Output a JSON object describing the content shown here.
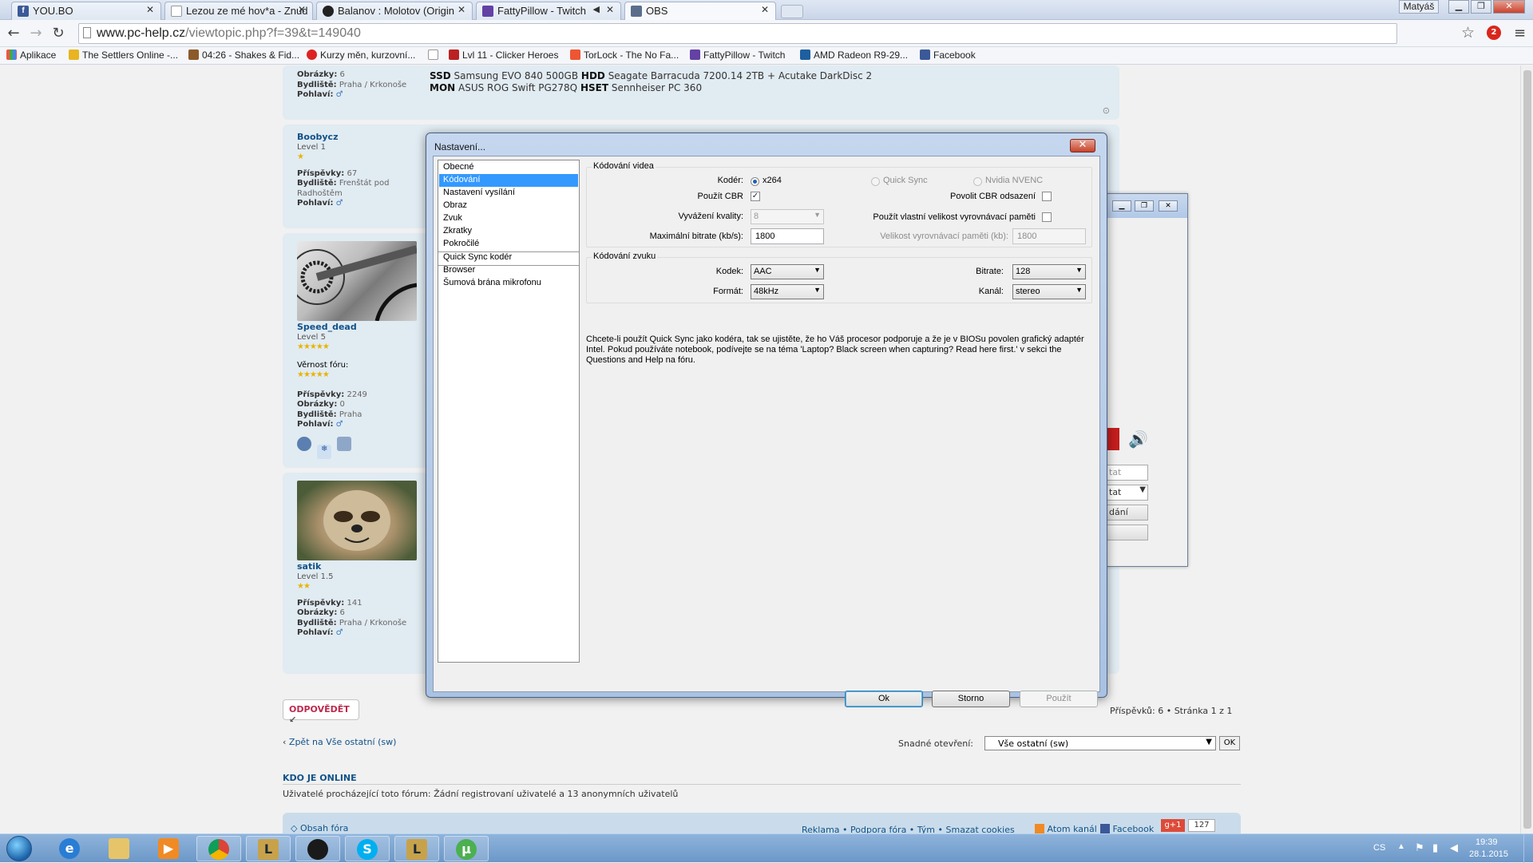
{
  "browser": {
    "tabs": [
      {
        "title": "YOU.BO",
        "icon": "facebook-icon",
        "color": "#3b5998"
      },
      {
        "title": "Lezou ze mé hov*a - Znud",
        "icon": "page-icon",
        "color": "#ffffff"
      },
      {
        "title": "Balanov : Molotov (Origin",
        "icon": "obs-icon",
        "color": "#222222"
      },
      {
        "title": "FattyPillow - Twitch",
        "icon": "twitch-icon",
        "color": "#6441a5"
      },
      {
        "title": "OBS",
        "icon": "obs-tab-icon",
        "color": "#5a6e8c"
      }
    ],
    "user": "Matyáš",
    "url_host": "www.pc-help.cz",
    "url_path": "/viewtopic.php?f=39&t=149040",
    "bookmarks": [
      "Aplikace",
      "The Settlers Online -...",
      "04:26 - Shakes & Fid...",
      "Kurzy měn, kurzovní...",
      "",
      "Lvl 11 - Clicker Heroes",
      "TorLock - The No Fa...",
      "FattyPillow - Twitch",
      "AMD Radeon R9-29...",
      "Facebook"
    ],
    "ext_badge": "2"
  },
  "forum": {
    "post0": {
      "obrazky_label": "Obrázky:",
      "obrazky": "6",
      "bydliste_label": "Bydliště:",
      "bydliste": "Praha / Krkonoše",
      "pohlavi_label": "Pohlaví:",
      "sig_line1_a": "SSD",
      "sig_line1_b": " Samsung EVO 840 500GB ",
      "sig_line1_c": "HDD",
      "sig_line1_d": " Seagate Barracuda 7200.14 2TB + Acutake DarkDisc 2",
      "sig_line2_a": "MON",
      "sig_line2_b": " ASUS ROG Swift PG278Q ",
      "sig_line2_c": "HSET",
      "sig_line2_d": " Sennheiser PC 360"
    },
    "post1": {
      "username": "Boobycz",
      "level": "Level 1",
      "stars": "★",
      "prispevky_label": "Příspěvky:",
      "prispevky": "67",
      "bydliste_label": "Bydliště:",
      "bydliste": "Frenštát pod Radhoštěm",
      "pohlavi_label": "Pohlaví:"
    },
    "post2": {
      "username": "Speed_dead",
      "level": "Level 5",
      "stars": "★★★★★",
      "vernost_label": "Věrnost fóru:",
      "vernost_stars": "★★★★★",
      "prispevky_label": "Příspěvky:",
      "prispevky": "2249",
      "obrazky_label": "Obrázky:",
      "obrazky": "0",
      "bydliste_label": "Bydliště:",
      "bydliste": "Praha",
      "pohlavi_label": "Pohlaví:"
    },
    "post3": {
      "username": "satik",
      "level": "Level 1.5",
      "stars": "★★",
      "prispevky_label": "Příspěvky:",
      "prispevky": "141",
      "obrazky_label": "Obrázky:",
      "obrazky": "6",
      "bydliste_label": "Bydliště:",
      "bydliste": "Praha / Krkonoše",
      "pohlavi_label": "Pohlaví:"
    },
    "reply_label": "ODPOVĚDĚT",
    "page_info": "Příspěvků: 6 • Stránka 1 z 1",
    "back_link": "Zpět na Vše ostatní (sw)",
    "jump_label": "Snadné otevření:",
    "jump_value": "Vše ostatní (sw)",
    "jump_ok": "OK",
    "online_heading": "KDO JE ONLINE",
    "online_text": "Uživatelé procházející toto fórum: Žádní registrovaní uživatelé a 13 anonymních uživatelů",
    "footer_left": "Obsah fóra",
    "footer_right": "Reklama • Podpora fóra • Tým • Smazat cookies",
    "footer_atom": "Atom kanál",
    "footer_fb": "Facebook",
    "footer_gplus": "g+1",
    "footer_count": "127"
  },
  "obs_main": {
    "field1": "tat",
    "field2": "tat",
    "field3": "dání"
  },
  "dialog": {
    "title": "Nastavení...",
    "categories": [
      "Obecné",
      "Kódování",
      "Nastavení vysílání",
      "Obraz",
      "Zvuk",
      "Zkratky",
      "Pokročilé",
      "Quick Sync kodér",
      "Browser",
      "Šumová brána mikrofonu"
    ],
    "selected_category": "Kódování",
    "video_group": "Kódování videa",
    "encoder_label": "Kodér:",
    "enc_x264": "x264",
    "enc_quicksync": "Quick Sync",
    "enc_nvenc": "Nvidia NVENC",
    "cbr_label": "Použít CBR",
    "cbr_checked": true,
    "cbr_padding_label": "Povolit CBR odsazení",
    "quality_label": "Vyvážení kvality:",
    "quality_value": "8",
    "custom_buffer_label": "Použít vlastní velikost vyrovnávací paměti",
    "max_bitrate_label": "Maximální bitrate (kb/s):",
    "max_bitrate": "1800",
    "buffer_size_label": "Velikost vyrovnávací paměti (kb):",
    "buffer_size": "1800",
    "audio_group": "Kódování zvuku",
    "codec_label": "Kodek:",
    "codec": "AAC",
    "bitrate_label": "Bitrate:",
    "bitrate": "128",
    "format_label": "Formát:",
    "format": "48kHz",
    "channel_label": "Kanál:",
    "channel": "stereo",
    "note": "Chcete-li použít Quick Sync jako kodéra, tak se ujistěte, že ho Váš procesor podporuje a že je v BIOSu povolen grafický adaptér Intel. Pokud používáte notebook, podívejte se na téma 'Laptop? Black screen when capturing? Read here first.' v sekci the Questions and Help na fóru.",
    "ok": "Ok",
    "cancel": "Storno",
    "apply": "Použít"
  },
  "taskbar": {
    "apps": [
      "explorer-icon",
      "ie-icon",
      "folder-icon",
      "media-icon",
      "chrome-icon",
      "lol-icon",
      "obs-icon",
      "skype-icon",
      "lol-icon",
      "utorrent-icon"
    ],
    "lang": "CS",
    "time": "19:39",
    "date": "28.1.2015"
  }
}
